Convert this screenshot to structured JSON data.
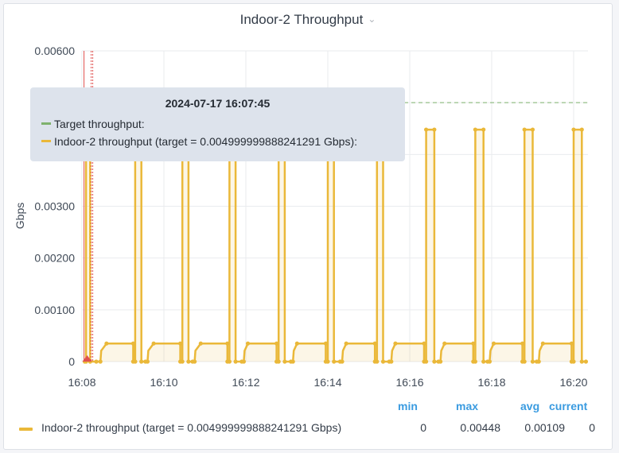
{
  "panel": {
    "title": "Indoor-2 Throughput"
  },
  "chart_data": {
    "type": "line",
    "ylabel": "Gbps",
    "ylim": [
      0,
      0.006
    ],
    "yticks": [
      {
        "value": 0,
        "label": "0"
      },
      {
        "value": 0.001,
        "label": "0.00100"
      },
      {
        "value": 0.002,
        "label": "0.00200"
      },
      {
        "value": 0.003,
        "label": "0.00300"
      },
      {
        "value": 0.006,
        "label": "0.00600"
      }
    ],
    "xlim": [
      8.0,
      20.35
    ],
    "xticks": [
      {
        "value": 8,
        "label": "16:08"
      },
      {
        "value": 10,
        "label": "16:10"
      },
      {
        "value": 12,
        "label": "16:12"
      },
      {
        "value": 14,
        "label": "16:14"
      },
      {
        "value": 16,
        "label": "16:16"
      },
      {
        "value": 18,
        "label": "16:18"
      },
      {
        "value": 20,
        "label": "16:20"
      }
    ],
    "series": [
      {
        "name": "Target throughput",
        "color": "#7eb26d",
        "style": "dashed",
        "value": 0.005
      },
      {
        "name": "Indoor-2 throughput (target = 0.004999999888241291 Gbps)",
        "color": "#eab839",
        "fill": true,
        "cycles": [
          {
            "start": 8.35,
            "low_start": 8.45,
            "plateau_start": 8.6,
            "plateau_end": 9.25,
            "peak_start": 9.3,
            "peak_end": 9.45
          },
          {
            "start": 9.55,
            "low_start": 9.6,
            "plateau_start": 9.75,
            "plateau_end": 10.4,
            "peak_start": 10.45,
            "peak_end": 10.6
          },
          {
            "start": 10.7,
            "low_start": 10.75,
            "plateau_start": 10.9,
            "plateau_end": 11.55,
            "peak_start": 11.6,
            "peak_end": 11.75
          },
          {
            "start": 11.9,
            "low_start": 11.95,
            "plateau_start": 12.05,
            "plateau_end": 12.75,
            "peak_start": 12.8,
            "peak_end": 12.95
          },
          {
            "start": 13.1,
            "low_start": 13.15,
            "plateau_start": 13.25,
            "plateau_end": 13.95,
            "peak_start": 14.0,
            "peak_end": 14.15
          },
          {
            "start": 14.3,
            "low_start": 14.35,
            "plateau_start": 14.45,
            "plateau_end": 15.15,
            "peak_start": 15.2,
            "peak_end": 15.35
          },
          {
            "start": 15.5,
            "low_start": 15.55,
            "plateau_start": 15.65,
            "plateau_end": 16.35,
            "peak_start": 16.4,
            "peak_end": 16.6
          },
          {
            "start": 16.7,
            "low_start": 16.75,
            "plateau_start": 16.85,
            "plateau_end": 17.55,
            "peak_start": 17.6,
            "peak_end": 17.8
          },
          {
            "start": 17.9,
            "low_start": 17.95,
            "plateau_start": 18.05,
            "plateau_end": 18.75,
            "peak_start": 18.8,
            "peak_end": 19.0
          },
          {
            "start": 19.1,
            "low_start": 19.15,
            "plateau_start": 19.25,
            "plateau_end": 19.95,
            "peak_start": 20.0,
            "peak_end": 20.2
          }
        ],
        "plateau_value": 0.00035,
        "peak_value": 0.00448,
        "end_x": 20.3
      }
    ],
    "marker_x": 8.05
  },
  "tooltip": {
    "time": "2024-07-17 16:07:45",
    "rows": [
      {
        "label": "Target throughput:",
        "color": "#7eb26d"
      },
      {
        "label": "Indoor-2 throughput (target = 0.004999999888241291 Gbps):",
        "color": "#eab839"
      }
    ]
  },
  "legend": {
    "headers": {
      "min": "min",
      "max": "max",
      "avg": "avg",
      "current": "current"
    },
    "rows": [
      {
        "label": "Indoor-2 throughput (target = 0.004999999888241291 Gbps)",
        "color": "#eab839",
        "min": "0",
        "max": "0.00448",
        "avg": "0.00109",
        "current": "0"
      }
    ]
  }
}
